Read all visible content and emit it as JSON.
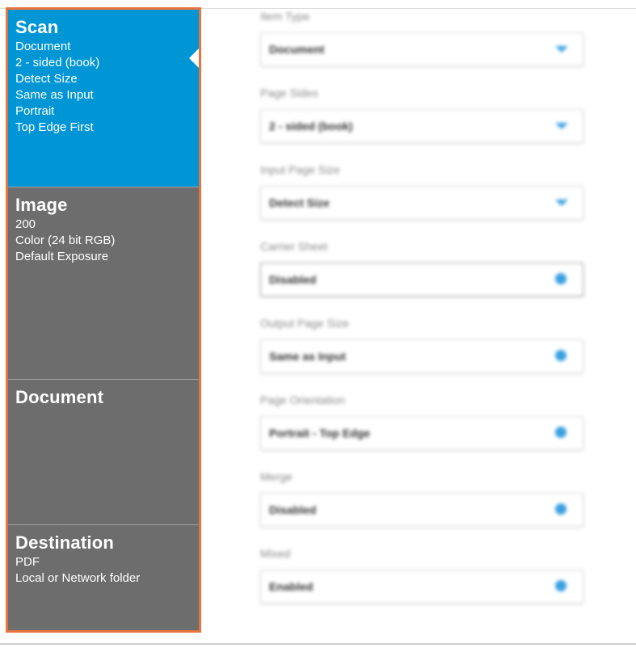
{
  "sidebar": {
    "scan": {
      "title": "Scan",
      "lines": [
        "Document",
        "2 - sided (book)",
        "Detect Size",
        "Same as Input",
        "Portrait",
        "Top Edge First"
      ]
    },
    "image": {
      "title": "Image",
      "lines": [
        "200",
        "Color (24 bit RGB)",
        "Default Exposure"
      ]
    },
    "document": {
      "title": "Document"
    },
    "destination": {
      "title": "Destination",
      "lines": [
        "PDF",
        "Local or Network folder"
      ]
    }
  },
  "form": {
    "fields": [
      {
        "label": "Item Type",
        "value": "Document",
        "indicator": "chevron-down-icon"
      },
      {
        "label": "Page Sides",
        "value": "2 - sided (book)",
        "indicator": "chevron-down-icon"
      },
      {
        "label": "Input Page Size",
        "value": "Detect Size",
        "indicator": "chevron-down-icon"
      },
      {
        "label": "Carrier Sheet",
        "value": "Disabled",
        "indicator": "plus-icon"
      },
      {
        "label": "Output Page Size",
        "value": "Same as Input",
        "indicator": "plus-icon"
      },
      {
        "label": "Page Orientation",
        "value": "Portrait - Top Edge",
        "indicator": "plus-icon"
      },
      {
        "label": "Merge",
        "value": "Disabled",
        "indicator": "plus-icon"
      },
      {
        "label": "Mixed",
        "value": "Enabled",
        "indicator": "plus-icon"
      }
    ]
  },
  "colors": {
    "active_panel": "#0096d6",
    "inactive_panel": "#6d6d6d",
    "highlight_border": "#e8743b",
    "accent": "#3aa0e0"
  }
}
